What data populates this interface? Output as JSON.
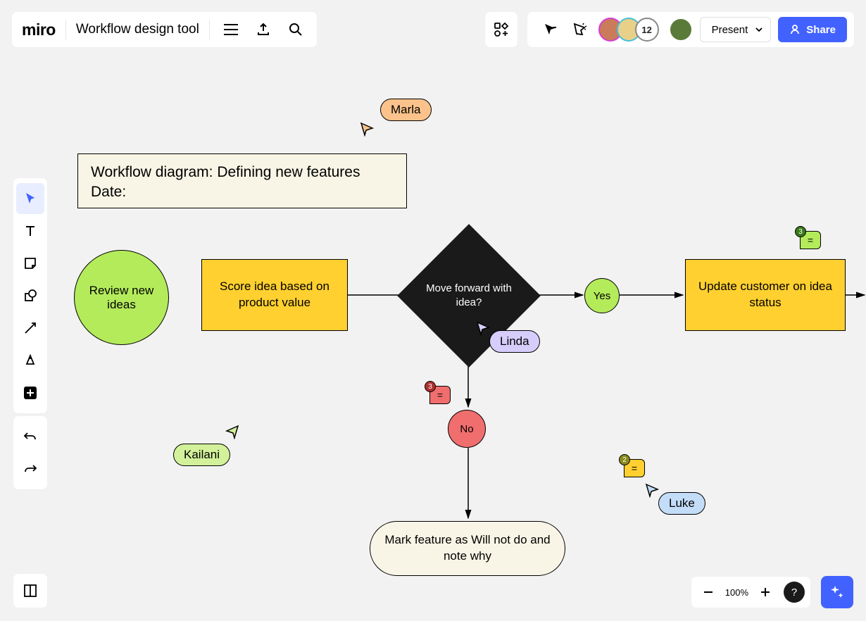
{
  "header": {
    "logo": "miro",
    "board_title": "Workflow design tool",
    "avatar_count": "12",
    "present_label": "Present",
    "share_label": "Share"
  },
  "zoom": {
    "percent": "100%"
  },
  "diagram": {
    "title_line1": "Workflow diagram: Defining new features",
    "title_line2": "Date:",
    "review": "Review new ideas",
    "score": "Score idea based on product value",
    "decision": "Move forward with idea?",
    "yes": "Yes",
    "no": "No",
    "update": "Update customer on idea status",
    "terminator": "Mark feature as Will not do and note why"
  },
  "cursors": {
    "marla": "Marla",
    "linda": "Linda",
    "kailani": "Kailani",
    "luke": "Luke"
  },
  "comments": {
    "red_count": "3",
    "yellow_count": "2",
    "green_count": "3",
    "glyph": "="
  },
  "colors": {
    "accent_blue": "#4262ff",
    "lime": "#b4eb5b",
    "yellow": "#ffd02f",
    "red": "#f06e6e",
    "cream": "#f8f5e6"
  }
}
